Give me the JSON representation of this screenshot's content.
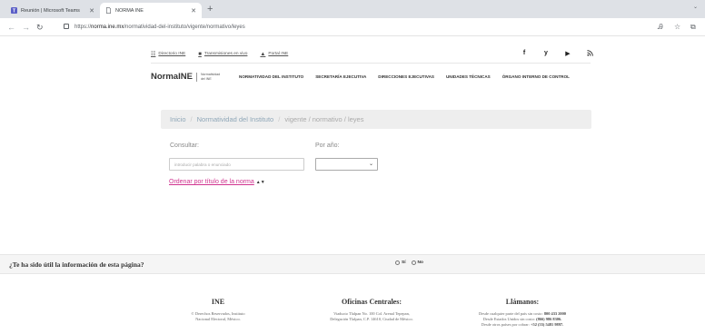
{
  "browser": {
    "tabs": [
      {
        "title": "Reunión | Microsoft Teams",
        "active": false
      },
      {
        "title": "NORMA INE",
        "active": true
      }
    ],
    "url_prefix": "https://",
    "url_host": "norma.ine.mx",
    "url_path": "/normatividad-del-instituto/vigente/normativo/leyes"
  },
  "utility": {
    "items": [
      {
        "label": "Directorio INE",
        "icon": "directory-icon"
      },
      {
        "label": "Transmisiones en vivo",
        "icon": "video-icon"
      },
      {
        "label": "Portal INE",
        "icon": "portal-icon"
      }
    ],
    "social": [
      "f",
      "y",
      "▶",
      "rss"
    ]
  },
  "header": {
    "brand": "NormaINE",
    "brand_sub": "Normatividad del INE",
    "nav": [
      "NORMATIVIDAD DEL INSTITUTO",
      "SECRETARÍA EJECUTIVA",
      "DIRECCIONES EJECUTIVAS",
      "UNIDADES TÉCNICAS",
      "ÓRGANO INTERNO DE CONTROL"
    ]
  },
  "breadcrumb": {
    "inicio": "Inicio",
    "normatividad": "Normatividad del Instituto",
    "current": "vigente / normativo / leyes"
  },
  "form": {
    "consultar_label": "Consultar:",
    "search_placeholder": "introducir palabra o enunciado",
    "year_label": "Por año:",
    "year_value": "",
    "sort_link": "Ordenar por título de la norma",
    "sort_arrows": "▲▼"
  },
  "feedback": {
    "question": "¿Te ha sido útil la información de esta página?",
    "yes": "Sí",
    "no": "No"
  },
  "footer": {
    "col1": {
      "title": "INE",
      "lines": [
        "© Derechos Reservados, Instituto",
        "Nacional Electoral, México."
      ]
    },
    "col2": {
      "title": "Oficinas Centrales:",
      "lines": [
        "Viaducto Tlalpan No. 100 Col. Arenal Tepepan,",
        "Delegación Tlalpan, C.P. 14610, Ciudad de México."
      ]
    },
    "col3": {
      "title": "Llámanos:",
      "line1_text": "Desde cualquier parte del país sin costo: ",
      "line1_num": "800 433 2000",
      "line2_text": "Desde Estados Unidos sin costo: ",
      "line2_num": "(866) 986 8306.",
      "line3_text": "Desde otros países por cobrar: ",
      "line3_num": "+52 (55) 5481 9897."
    }
  },
  "colors": {
    "accent_link": "#d0338f",
    "breadcrumb_link": "#8fa7b8"
  }
}
